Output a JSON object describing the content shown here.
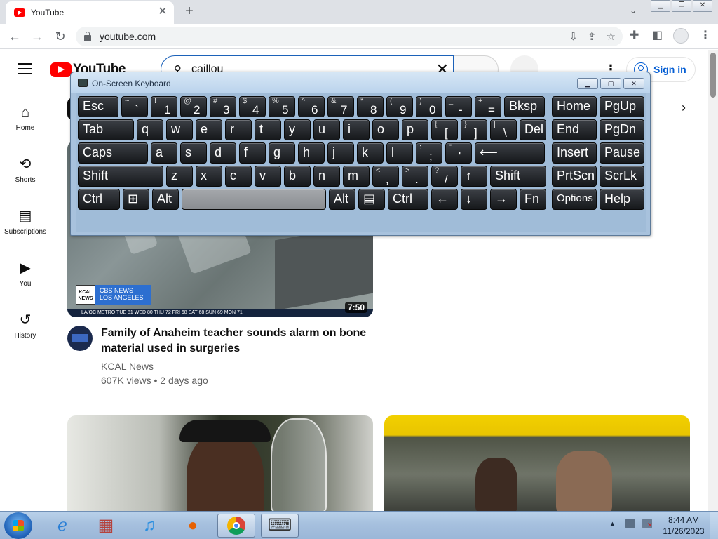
{
  "browser": {
    "tab_title": "YouTube",
    "tab_close": "✕",
    "new_tab": "+",
    "url": "youtube.com"
  },
  "youtube": {
    "logo_text": "YouTube",
    "search_query": "caillou",
    "sign_in": "Sign in",
    "sidebar": [
      {
        "icon": "⌂",
        "label": "Home"
      },
      {
        "icon": "⟲",
        "label": "Shorts"
      },
      {
        "icon": "▤",
        "label": "Subscriptions"
      },
      {
        "icon": "▶",
        "label": "You"
      },
      {
        "icon": "↺",
        "label": "History"
      }
    ],
    "video": {
      "title": "Family of Anaheim teacher sounds alarm on bone material used in surgeries",
      "channel": "KCAL News",
      "stats": "607K views • 2 days ago",
      "duration": "7:50",
      "badge_kcal": "KCAL NEWS",
      "badge_cbs_1": "CBS NEWS",
      "badge_cbs_2": "LOS ANGELES",
      "ticker": "LA/OC METRO   TUE 81   WED 80   THU 72   FRI 68   SAT 68   SUN 69   MON 71"
    }
  },
  "osk": {
    "title": "On-Screen Keyboard",
    "rows": [
      [
        {
          "l": "Esc"
        },
        {
          "s": "~",
          "m": "`"
        },
        {
          "s": "!",
          "m": "1"
        },
        {
          "s": "@",
          "m": "2"
        },
        {
          "s": "#",
          "m": "3"
        },
        {
          "s": "$",
          "m": "4"
        },
        {
          "s": "%",
          "m": "5"
        },
        {
          "s": "^",
          "m": "6"
        },
        {
          "s": "&",
          "m": "7"
        },
        {
          "s": "*",
          "m": "8"
        },
        {
          "s": "(",
          "m": "9"
        },
        {
          "s": ")",
          "m": "0"
        },
        {
          "s": "_",
          "m": "-"
        },
        {
          "s": "+",
          "m": "="
        },
        {
          "l": "Bksp"
        },
        {
          "l": "Home"
        },
        {
          "l": "PgUp"
        }
      ],
      [
        {
          "l": "Tab"
        },
        {
          "l": "q"
        },
        {
          "l": "w"
        },
        {
          "l": "e"
        },
        {
          "l": "r"
        },
        {
          "l": "t"
        },
        {
          "l": "y"
        },
        {
          "l": "u"
        },
        {
          "l": "i"
        },
        {
          "l": "o"
        },
        {
          "l": "p"
        },
        {
          "s": "{",
          "m": "["
        },
        {
          "s": "}",
          "m": "]"
        },
        {
          "s": "|",
          "m": "\\"
        },
        {
          "l": "Del"
        },
        {
          "l": "End"
        },
        {
          "l": "PgDn"
        }
      ],
      [
        {
          "l": "Caps"
        },
        {
          "l": "a"
        },
        {
          "l": "s"
        },
        {
          "l": "d"
        },
        {
          "l": "f"
        },
        {
          "l": "g"
        },
        {
          "l": "h"
        },
        {
          "l": "j"
        },
        {
          "l": "k"
        },
        {
          "l": "l"
        },
        {
          "s": ":",
          "m": ";"
        },
        {
          "s": "\"",
          "m": "'"
        },
        {
          "l": "⟵"
        },
        {
          "l": "Insert"
        },
        {
          "l": "Pause"
        }
      ],
      [
        {
          "l": "Shift"
        },
        {
          "l": "z"
        },
        {
          "l": "x"
        },
        {
          "l": "c"
        },
        {
          "l": "v"
        },
        {
          "l": "b"
        },
        {
          "l": "n"
        },
        {
          "l": "m"
        },
        {
          "s": "<",
          "m": ","
        },
        {
          "s": ">",
          "m": "."
        },
        {
          "s": "?",
          "m": "/"
        },
        {
          "l": "↑"
        },
        {
          "l": "Shift"
        },
        {
          "l": "PrtScn"
        },
        {
          "l": "ScrLk"
        }
      ],
      [
        {
          "l": "Ctrl"
        },
        {
          "l": "⊞"
        },
        {
          "l": "Alt"
        },
        {
          "l": ""
        },
        {
          "l": "Alt"
        },
        {
          "l": "▤"
        },
        {
          "l": "Ctrl"
        },
        {
          "l": "←"
        },
        {
          "l": "↓"
        },
        {
          "l": "→"
        },
        {
          "l": "Fn"
        },
        {
          "l": "Options"
        },
        {
          "l": "Help"
        }
      ]
    ]
  },
  "taskbar": {
    "time": "8:44 AM",
    "date": "11/26/2023",
    "apps": [
      "Internet Explorer",
      "Store",
      "iTunes",
      "Firefox",
      "Chrome",
      "On-Screen Keyboard"
    ]
  },
  "colors": {
    "yt_red": "#ff0000",
    "link_blue": "#065fd4",
    "osk_frame": "#a8c2dd"
  }
}
